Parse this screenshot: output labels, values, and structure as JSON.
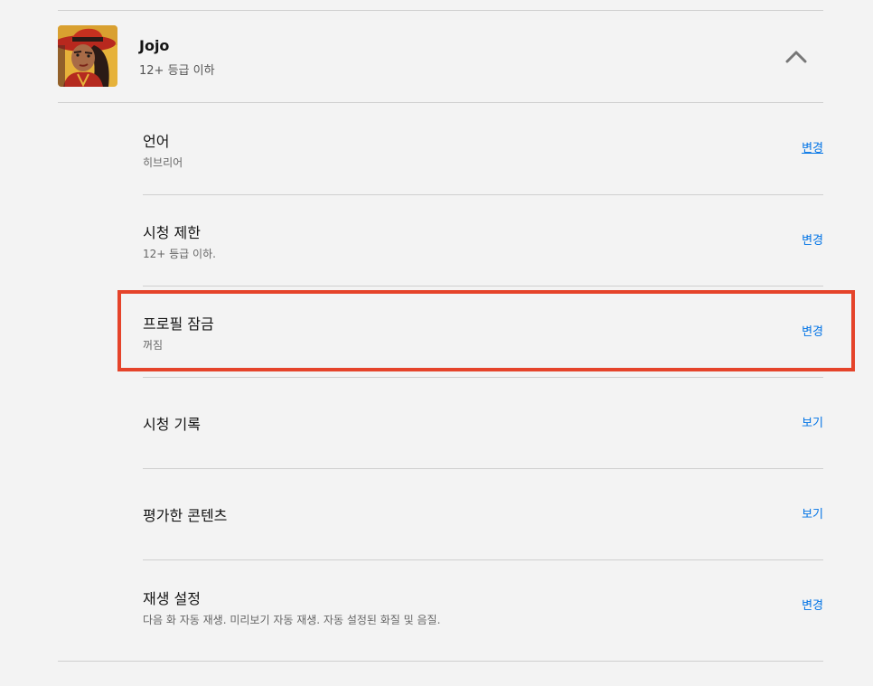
{
  "profile": {
    "name": "Jojo",
    "maturity": "12+ 등급 이하",
    "avatar_icon": "profile-avatar-red-hat-character",
    "expand_icon": "chevron-up-icon"
  },
  "settings": [
    {
      "title": "언어",
      "subtitle": "히브리어",
      "action": "변경"
    },
    {
      "title": "시청 제한",
      "subtitle": "12+ 등급 이하.",
      "action": "변경"
    },
    {
      "title": "프로필 잠금",
      "subtitle": "꺼짐",
      "action": "변경"
    },
    {
      "title": "시청 기록",
      "subtitle": "",
      "action": "보기"
    },
    {
      "title": "평가한 콘텐츠",
      "subtitle": "",
      "action": "보기"
    },
    {
      "title": "재생 설정",
      "subtitle": "다음 화 자동 재생. 미리보기 자동 재생. 자동 설정된 화질 및 음질.",
      "action": "변경"
    }
  ],
  "colors": {
    "background": "#f3f3f3",
    "link": "#0073e6",
    "highlight": "#e5432a",
    "divider": "#cfcfcf"
  }
}
